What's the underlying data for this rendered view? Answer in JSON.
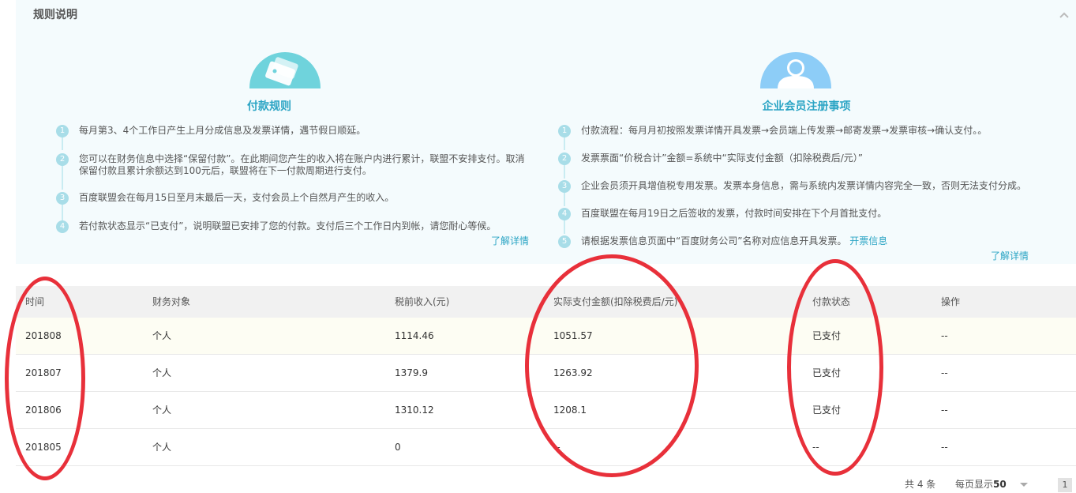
{
  "rules": {
    "title": "规则说明",
    "payment": {
      "heading": "付款规则",
      "steps": [
        {
          "num": "1",
          "text": "每月第3、4个工作日产生上月分成信息及发票详情，遇节假日顺延。"
        },
        {
          "num": "2",
          "text": "您可以在财务信息中选择“保留付款”。在此期间您产生的收入将在账户内进行累计，联盟不安排支付。取消保留付款且累计余额达到100元后，联盟将在下一付款周期进行支付。"
        },
        {
          "num": "3",
          "text": "百度联盟会在每月15日至月末最后一天，支付会员上个自然月产生的收入。"
        },
        {
          "num": "4",
          "text": "若付款状态显示“已支付”，说明联盟已安排了您的付款。支付后三个工作日内到帐，请您耐心等候。"
        }
      ],
      "more_link": "了解详情"
    },
    "enterprise": {
      "heading": "企业会员注册事项",
      "steps": [
        {
          "num": "1",
          "text": "付款流程：每月月初按照发票详情开具发票→会员端上传发票→邮寄发票→发票审核→确认支付。。"
        },
        {
          "num": "2",
          "text": "发票票面“价税合计”金额=系统中“实际支付金额（扣除税费后/元）”"
        },
        {
          "num": "3",
          "text": "企业会员须开具增值税专用发票。发票本身信息，需与系统内发票详情内容完全一致，否则无法支付分成。"
        },
        {
          "num": "4",
          "text": "百度联盟在每月19日之后签收的发票，付款时间安排在下个月首批支付。"
        },
        {
          "num": "5",
          "text": "请根据发票信息页面中“百度财务公司”名称对应信息开具发票。",
          "link": "开票信息"
        }
      ],
      "more_link": "了解详情"
    }
  },
  "table": {
    "headers": [
      "时间",
      "财务对象",
      "税前收入(元)",
      "实际支付金额(扣除税费后/元)",
      "付款状态",
      "操作"
    ],
    "rows": [
      [
        "201808",
        "个人",
        "1114.46",
        "1051.57",
        "已支付",
        "--"
      ],
      [
        "201807",
        "个人",
        "1379.9",
        "1263.92",
        "已支付",
        "--"
      ],
      [
        "201806",
        "个人",
        "1310.12",
        "1208.1",
        "已支付",
        "--"
      ],
      [
        "201805",
        "个人",
        "0",
        "--",
        "--",
        "--"
      ]
    ]
  },
  "pager": {
    "total": "共 4 条",
    "page_size_label": "每页显示",
    "page_size": "50",
    "current_page": "1"
  },
  "colors": {
    "accent": "#2aa4c4",
    "annotation": "#e8303a",
    "panel_bg": "#f4fbfd"
  }
}
